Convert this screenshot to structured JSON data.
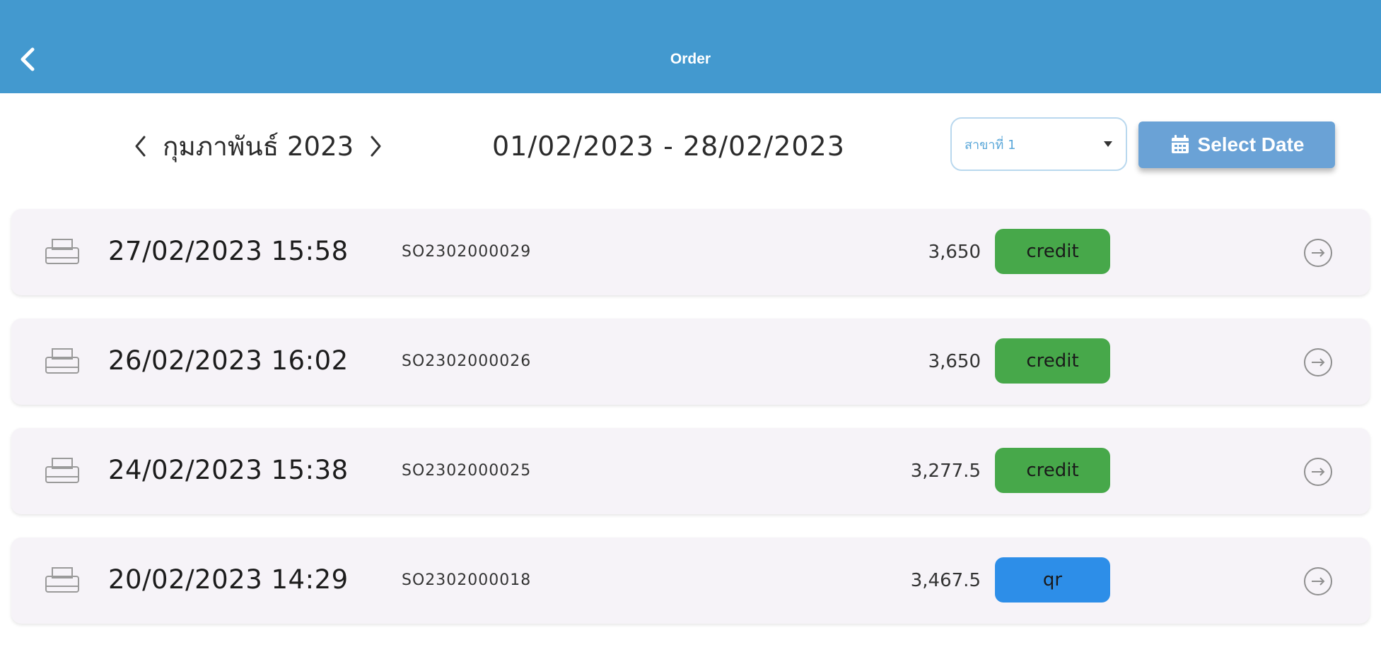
{
  "appbar": {
    "title": "Order",
    "back_icon": "chevron-left-icon",
    "background": "#4399cf"
  },
  "filters": {
    "month_label": "กุมภาพันธ์ 2023",
    "date_range": "01/02/2023 - 28/02/2023",
    "branch_select": {
      "value": "สาขาที่ 1"
    },
    "select_date_label": "Select Date"
  },
  "orders": [
    {
      "datetime": "27/02/2023 15:58",
      "order_no": "SO2302000029",
      "amount": "3,650",
      "payment": "credit",
      "payment_color": "#47a84a"
    },
    {
      "datetime": "26/02/2023 16:02",
      "order_no": "SO2302000026",
      "amount": "3,650",
      "payment": "credit",
      "payment_color": "#47a84a"
    },
    {
      "datetime": "24/02/2023 15:38",
      "order_no": "SO2302000025",
      "amount": "3,277.5",
      "payment": "credit",
      "payment_color": "#47a84a"
    },
    {
      "datetime": "20/02/2023 14:29",
      "order_no": "SO2302000018",
      "amount": "3,467.5",
      "payment": "qr",
      "payment_color": "#2d8ee8"
    }
  ]
}
